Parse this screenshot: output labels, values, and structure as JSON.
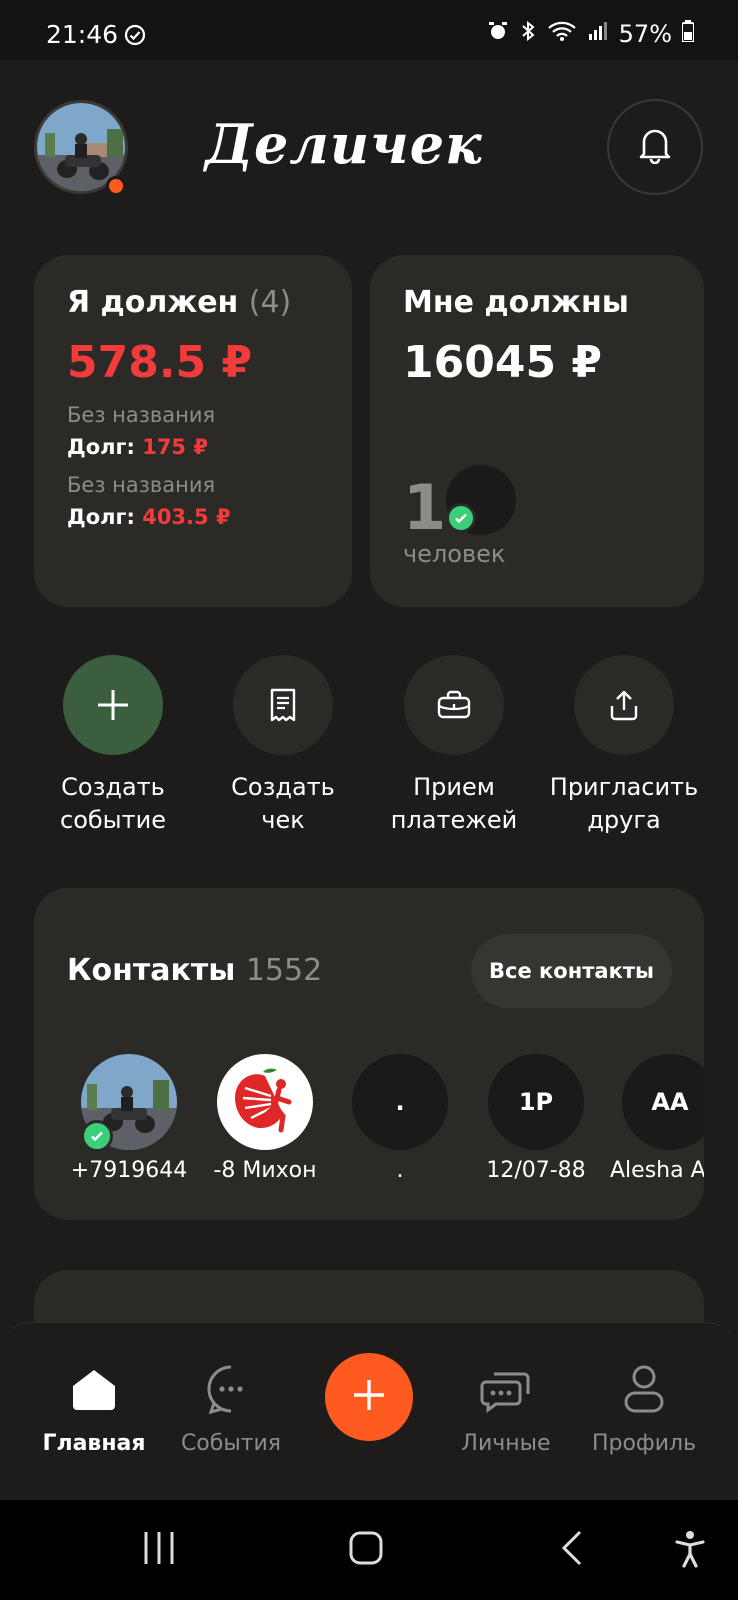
{
  "status": {
    "time": "21:46",
    "battery": "57%"
  },
  "header": {
    "logo": "Деличек",
    "avatar_image": "motorcycle rider photo"
  },
  "owe_card": {
    "title": "Я должен",
    "count": "(4)",
    "total": "578.5 ₽",
    "debts": [
      {
        "name": "Без названия",
        "label": "Долг:",
        "amount": "175 ₽"
      },
      {
        "name": "Без названия",
        "label": "Долг:",
        "amount": "403.5 ₽"
      }
    ]
  },
  "owed_card": {
    "title": "Мне должны",
    "total": "16045 ₽",
    "people_count": "1",
    "people_label": "человек"
  },
  "actions": [
    {
      "label": "Создать событие",
      "icon": "plus-icon"
    },
    {
      "label": "Создать чек",
      "icon": "receipt-icon"
    },
    {
      "label": "Прием платежей",
      "icon": "wallet-icon"
    },
    {
      "label": "Пригласить друга",
      "icon": "share-icon"
    }
  ],
  "contacts": {
    "title": "Контакты",
    "count": "1552",
    "all_button": "Все контакты",
    "items": [
      {
        "name": "+7919644",
        "initials": ""
      },
      {
        "name": "-8 Михон",
        "initials": ""
      },
      {
        "name": ".",
        "initials": "."
      },
      {
        "name": "12/07-88",
        "initials": "1P"
      },
      {
        "name": "Alesha A",
        "initials": "AA"
      }
    ]
  },
  "nav": {
    "home": "Главная",
    "events": "События",
    "personal": "Личные",
    "profile": "Профиль"
  },
  "colors": {
    "accent": "#ff5a1f",
    "red": "#f23b3b",
    "green": "#3ccf7a",
    "card": "#2b2a27",
    "bg": "#1d1c1a"
  }
}
